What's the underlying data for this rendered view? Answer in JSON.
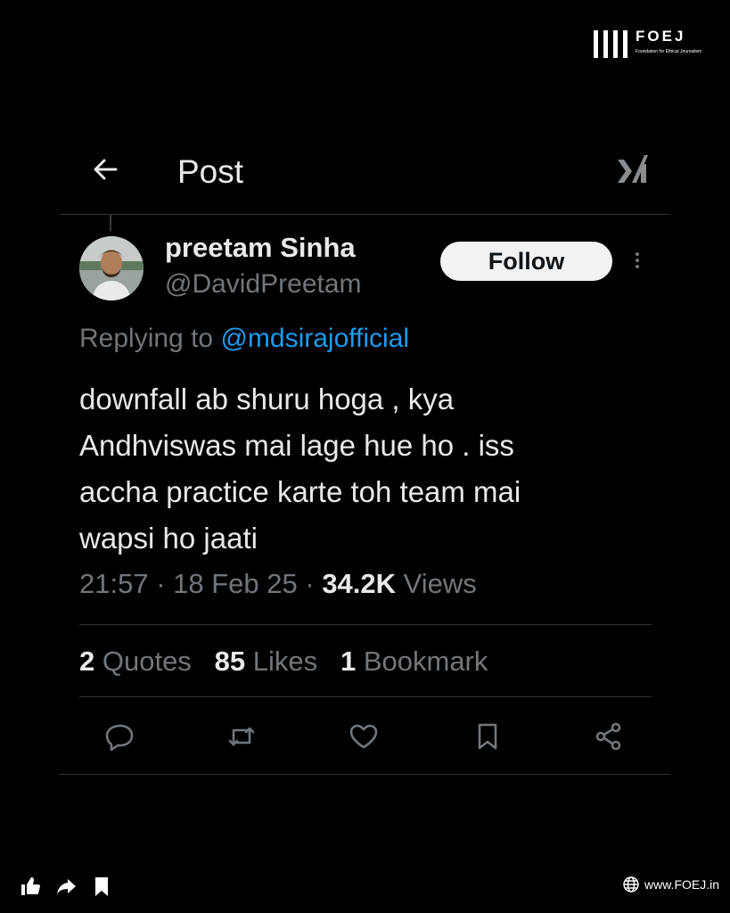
{
  "brand": {
    "logo_text": "FOEJ",
    "logo_subtitle": "Foundation for Ethical Journalism",
    "website": "www.FOEJ.in"
  },
  "header": {
    "title": "Post",
    "back_icon": "arrow-left-icon",
    "brand_icon": "x-logo-icon"
  },
  "post": {
    "author_name": "preetam Sinha",
    "author_handle": "@DavidPreetam",
    "follow_label": "Follow",
    "replying_prefix": "Replying to ",
    "replying_to": "@mdsirajofficial",
    "text_lines": [
      "downfall ab shuru hoga , kya",
      "Andhviswas mai lage hue ho . iss",
      "accha practice karte toh team mai",
      "wapsi ho jaati"
    ],
    "time": "21:57",
    "date": "18 Feb 25",
    "separator": " · ",
    "views_count": "34.2K",
    "views_label": " Views",
    "quotes_count": "2",
    "quotes_label": " Quotes",
    "likes_count": "85",
    "likes_label": " Likes",
    "bookmarks_count": "1",
    "bookmarks_label": " Bookmark"
  },
  "actions": [
    "reply-icon",
    "repost-icon",
    "like-icon",
    "bookmark-icon",
    "share-icon"
  ],
  "footer_icons": [
    "thumbs-up-icon",
    "share-arrow-icon",
    "bookmark-icon",
    "globe-icon"
  ],
  "colors": {
    "background": "#000000",
    "text": "#e7e9ea",
    "muted": "#71767b",
    "accent": "#1d9bf0",
    "divider": "#2f3336"
  }
}
